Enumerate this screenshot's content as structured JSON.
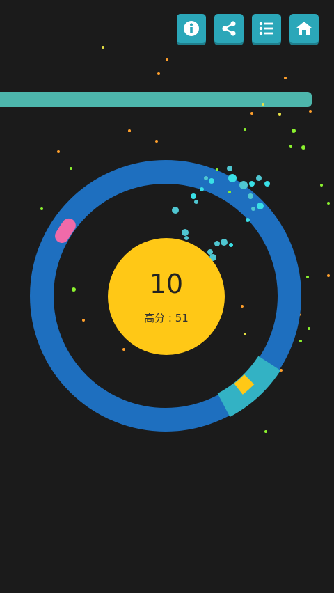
{
  "toolbar": {
    "buttons": [
      {
        "name": "info-button",
        "icon": "info-icon"
      },
      {
        "name": "share-button",
        "icon": "share-icon"
      },
      {
        "name": "list-button",
        "icon": "list-icon"
      },
      {
        "name": "home-button",
        "icon": "home-icon"
      }
    ]
  },
  "progress": {
    "fraction": 1.0,
    "color": "#4db6ac"
  },
  "game": {
    "score": "10",
    "highscore_label": "高分",
    "highscore_separator": " : ",
    "highscore_value": "51",
    "ring_color": "#1e6fbf",
    "disc_color": "#ffc816",
    "pink_block_color": "#ef6aa9",
    "cyan_block_color": "#33b2c4",
    "yellow_block_color": "#ffc816",
    "particle_colors": [
      "#3ae0e6",
      "#4fc6d1",
      "#8bf12f",
      "#ff9f2b",
      "#e6e045"
    ]
  }
}
